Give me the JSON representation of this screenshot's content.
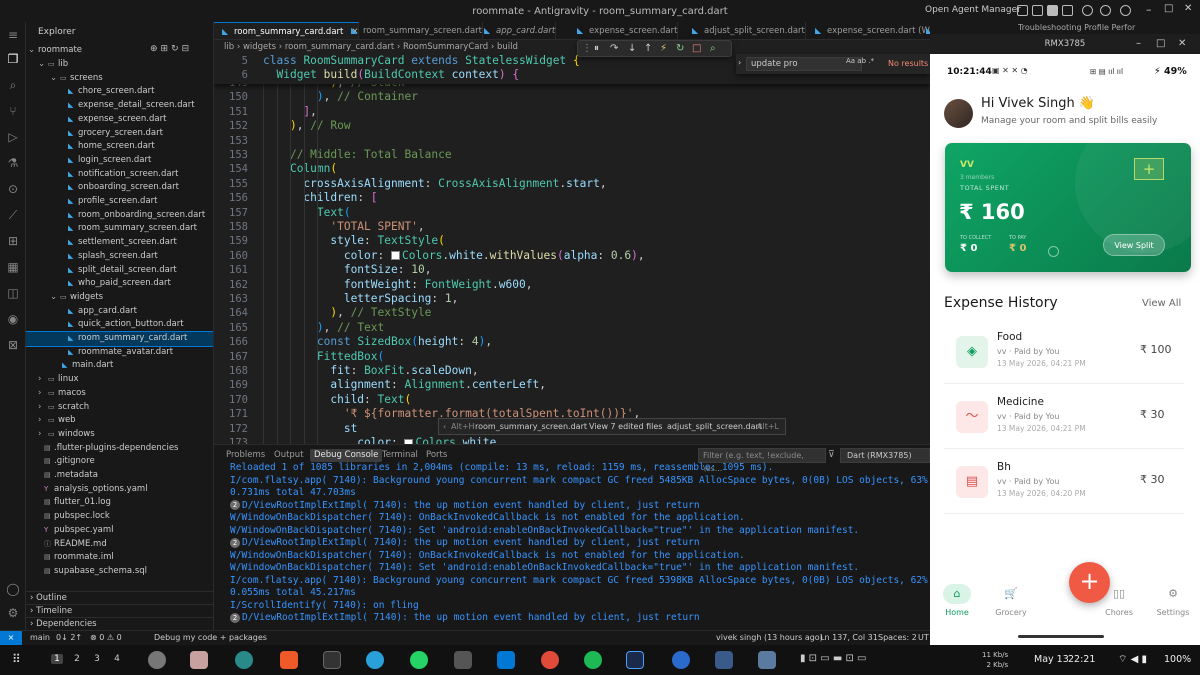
{
  "window": {
    "title": "roommate - Antigravity - room_summary_card.dart",
    "open_agent_manager": "Open Agent Manager"
  },
  "explorer": {
    "header": "Explorer",
    "root": "roommate",
    "items": [
      {
        "label": "lib",
        "kind": "folder"
      },
      {
        "label": "screens",
        "kind": "folder"
      },
      {
        "label": "chore_screen.dart",
        "kind": "dart"
      },
      {
        "label": "expense_detail_screen.dart",
        "kind": "dart"
      },
      {
        "label": "expense_screen.dart",
        "kind": "dart"
      },
      {
        "label": "grocery_screen.dart",
        "kind": "dart"
      },
      {
        "label": "home_screen.dart",
        "kind": "dart"
      },
      {
        "label": "login_screen.dart",
        "kind": "dart"
      },
      {
        "label": "notification_screen.dart",
        "kind": "dart"
      },
      {
        "label": "onboarding_screen.dart",
        "kind": "dart"
      },
      {
        "label": "profile_screen.dart",
        "kind": "dart"
      },
      {
        "label": "room_onboarding_screen.dart",
        "kind": "dart"
      },
      {
        "label": "room_summary_screen.dart",
        "kind": "dart"
      },
      {
        "label": "settlement_screen.dart",
        "kind": "dart"
      },
      {
        "label": "splash_screen.dart",
        "kind": "dart"
      },
      {
        "label": "split_detail_screen.dart",
        "kind": "dart"
      },
      {
        "label": "who_paid_screen.dart",
        "kind": "dart"
      },
      {
        "label": "widgets",
        "kind": "folder"
      },
      {
        "label": "app_card.dart",
        "kind": "dart"
      },
      {
        "label": "quick_action_button.dart",
        "kind": "dart"
      },
      {
        "label": "room_summary_card.dart",
        "kind": "dart"
      },
      {
        "label": "roommate_avatar.dart",
        "kind": "dart"
      },
      {
        "label": "main.dart",
        "kind": "dart"
      },
      {
        "label": "linux",
        "kind": "folder"
      },
      {
        "label": "macos",
        "kind": "folder"
      },
      {
        "label": "scratch",
        "kind": "folder"
      },
      {
        "label": "web",
        "kind": "folder"
      },
      {
        "label": "windows",
        "kind": "folder"
      },
      {
        "label": ".flutter-plugins-dependencies",
        "kind": "file"
      },
      {
        "label": ".gitignore",
        "kind": "file"
      },
      {
        "label": ".metadata",
        "kind": "file"
      },
      {
        "label": "analysis_options.yaml",
        "kind": "yaml"
      },
      {
        "label": "flutter_01.log",
        "kind": "file"
      },
      {
        "label": "pubspec.lock",
        "kind": "file"
      },
      {
        "label": "pubspec.yaml",
        "kind": "yaml"
      },
      {
        "label": "README.md",
        "kind": "md"
      },
      {
        "label": "roommate.iml",
        "kind": "file"
      },
      {
        "label": "supabase_schema.sql",
        "kind": "file"
      }
    ],
    "outline": "Outline",
    "timeline": "Timeline",
    "dependencies": "Dependencies"
  },
  "tabs": [
    {
      "label": "room_summary_card.dart",
      "active": true
    },
    {
      "label": "room_summary_screen.dart",
      "active": false
    },
    {
      "label": "app_card.dart",
      "active": false
    },
    {
      "label": "expense_screen.dart",
      "active": false
    },
    {
      "label": "adjust_split_screen.dart",
      "active": false
    },
    {
      "label": "expense_screen.dart (Workin",
      "active": false
    },
    {
      "label": "Troubleshooting Profile Perfor",
      "active": false
    }
  ],
  "breadcrumb": {
    "parts": [
      "lib",
      "widgets",
      "room_summary_card.dart",
      "RoomSummaryCard",
      "build"
    ]
  },
  "find": {
    "value": "update pro",
    "options": "Aa  ab  .*",
    "result": "No results"
  },
  "editor": {
    "sticky": [
      {
        "n": "5",
        "code": "<span class=\"kw\">class</span> <span class=\"ty\">RoomSummaryCard</span> <span class=\"kw\">extends</span> <span class=\"ty\">StatelessWidget</span> <span class=\"br1\">{</span>"
      },
      {
        "n": "6",
        "code": "  <span class=\"ty\">Widget</span> <span class=\"fn\">build</span><span class=\"br2\">(</span><span class=\"ty\">BuildContext</span> <span class=\"pr\">context</span><span class=\"br2\">)</span> <span class=\"br2\">{</span>"
      }
    ],
    "lines": [
      {
        "n": "149",
        "code": "          <span class=\"br1\">)</span>, <span class=\"cm\">// Stack</span>"
      },
      {
        "n": "150",
        "code": "        <span class=\"br3\">)</span>, <span class=\"cm\">// Container</span>"
      },
      {
        "n": "151",
        "code": "      <span class=\"br2\">]</span>,"
      },
      {
        "n": "152",
        "code": "    <span class=\"br1\">)</span>, <span class=\"cm\">// Row</span>"
      },
      {
        "n": "153",
        "code": ""
      },
      {
        "n": "153",
        "code": "    <span class=\"cm\">// Middle: Total Balance</span>"
      },
      {
        "n": "154",
        "code": "    <span class=\"ty\">Column</span><span class=\"br1\">(</span>"
      },
      {
        "n": "155",
        "code": "      <span class=\"pr\">crossAxisAlignment</span>: <span class=\"ty\">CrossAxisAlignment</span>.<span class=\"pr\">start</span>,"
      },
      {
        "n": "156",
        "code": "      <span class=\"pr\">children</span>: <span class=\"br2\">[</span>"
      },
      {
        "n": "157",
        "code": "        <span class=\"ty\">Text</span><span class=\"br3\">(</span>"
      },
      {
        "n": "158",
        "code": "          <span class=\"st\">'TOTAL SPENT'</span>,"
      },
      {
        "n": "159",
        "code": "          <span class=\"pr\">style</span>: <span class=\"ty\">TextStyle</span><span class=\"br1\">(</span>"
      },
      {
        "n": "160",
        "code": "            <span class=\"pr\">color</span>: <span class=\"swatch\"></span><span class=\"ty\">Colors</span>.<span class=\"pr\">white</span>.<span class=\"fn\">withValues</span><span class=\"br2\">(</span><span class=\"pr\">alpha</span>: <span class=\"nu\">0.6</span><span class=\"br2\">)</span>,"
      },
      {
        "n": "161",
        "code": "            <span class=\"pr\">fontSize</span>: <span class=\"nu\">10</span>,"
      },
      {
        "n": "162",
        "code": "            <span class=\"pr\">fontWeight</span>: <span class=\"ty\">FontWeight</span>.<span class=\"pr\">w600</span>,"
      },
      {
        "n": "163",
        "code": "            <span class=\"pr\">letterSpacing</span>: <span class=\"nu\">1</span>,"
      },
      {
        "n": "164",
        "code": "          <span class=\"br1\">)</span>, <span class=\"cm\">// TextStyle</span>"
      },
      {
        "n": "165",
        "code": "        <span class=\"br3\">)</span>, <span class=\"cm\">// Text</span>"
      },
      {
        "n": "166",
        "code": "        <span class=\"kw\">const</span> <span class=\"ty\">SizedBox</span><span class=\"br3\">(</span><span class=\"pr\">height</span>: <span class=\"nu\">4</span><span class=\"br3\">)</span>,"
      },
      {
        "n": "167",
        "code": "        <span class=\"ty\">FittedBox</span><span class=\"br3\">(</span>"
      },
      {
        "n": "168",
        "code": "          <span class=\"pr\">fit</span>: <span class=\"ty\">BoxFit</span>.<span class=\"pr\">scaleDown</span>,"
      },
      {
        "n": "169",
        "code": "          <span class=\"pr\">alignment</span>: <span class=\"ty\">Alignment</span>.<span class=\"pr\">centerLeft</span>,"
      },
      {
        "n": "170",
        "code": "          <span class=\"pr\">child</span>: <span class=\"ty\">Text</span><span class=\"br1\">(</span>"
      },
      {
        "n": "171",
        "code": "            <span class=\"st\">'₹ ${formatter.format(totalSpent.toInt())}'</span>,"
      },
      {
        "n": "172",
        "code": "            <span class=\"pr\">st</span>"
      },
      {
        "n": "173",
        "code": "              <span class=\"pr\">color</span>: <span class=\"swatch\"></span><span class=\"ty\">Colors</span>.<span class=\"pr\">white</span>,"
      }
    ]
  },
  "switcher": {
    "hint": "Alt+H",
    "item1": "room_summary_screen.dart",
    "item2": "View 7 edited files",
    "item3": "adjust_split_screen.dart",
    "hint2": "Alt+L"
  },
  "panel": {
    "tabs": [
      "Problems",
      "Output",
      "Debug Console",
      "Terminal",
      "Ports"
    ],
    "active_tab": "Debug Console",
    "filter_placeholder": "Filter (e.g. text, !exclude, \\es...",
    "device": "Dart (RMX3785)",
    "logs": [
      {
        "badge": "",
        "text": "Reloaded 1 of 1085 libraries in 2,004ms (compile: 13 ms, reload: 1159 ms, reassemble: 1095 ms)."
      },
      {
        "badge": "",
        "text": "I/com.flatsy.app( 7140): Background young concurrent mark compact GC freed 5485KB AllocSpace bytes, 0(0B) LOS objects, 63% free, 3191KB/8650KB"
      },
      {
        "badge": "",
        "text": "0.731ms total 47.703ms"
      },
      {
        "badge": "2",
        "text": "D/ViewRootImplExtImpl( 7140): the up motion event handled by client, just return"
      },
      {
        "badge": "",
        "text": "W/WindowOnBackDispatcher( 7140): OnBackInvokedCallback is not enabled for the application."
      },
      {
        "badge": "",
        "text": "W/WindowOnBackDispatcher( 7140): Set 'android:enableOnBackInvokedCallback=\"true\"' in the application manifest."
      },
      {
        "badge": "2",
        "text": "D/ViewRootImplExtImpl( 7140): the up motion event handled by client, just return"
      },
      {
        "badge": "",
        "text": "W/WindowOnBackDispatcher( 7140): OnBackInvokedCallback is not enabled for the application."
      },
      {
        "badge": "",
        "text": "W/WindowOnBackDispatcher( 7140): Set 'android:enableOnBackInvokedCallback=\"true\"' in the application manifest."
      },
      {
        "badge": "",
        "text": "I/com.flatsy.app( 7140): Background young concurrent mark compact GC freed 5398KB AllocSpace bytes, 0(0B) LOS objects, 62% free, 3279KB/8650KB"
      },
      {
        "badge": "",
        "text": "0.055ms total 45.217ms"
      },
      {
        "badge": "",
        "text": "I/ScrollIdentify( 7140): on fling"
      },
      {
        "badge": "2",
        "text": "D/ViewRootImplExtImpl( 7140): the up motion event handled by client, just return"
      }
    ]
  },
  "status": {
    "branch": "main",
    "sync": "0↓ 2↑",
    "errors": "⊗ 0 ⚠ 0",
    "debug": "Debug my code + packages",
    "blame": "vivek singh (13 hours ago)",
    "position": "Ln 137, Col 31",
    "spaces": "Spaces: 2",
    "encoding": "UT"
  },
  "emulator": {
    "title": "RMX3785",
    "top_text": "Troubleshooting Profile Perfor"
  },
  "phone": {
    "time": "10:21:44",
    "battery": "49%",
    "greeting": "Hi Vivek Singh 👋",
    "subtitle": "Manage your room and split bills easily",
    "card": {
      "group": "VV",
      "members": "3 members",
      "total_label": "TOTAL SPENT",
      "total": "₹ 160",
      "collect_label": "TO COLLECT",
      "collect": "₹ 0",
      "pay_label": "TO PAY",
      "pay": "₹ 0",
      "view_split": "View Split"
    },
    "history_title": "Expense History",
    "view_all": "View All",
    "expenses": [
      {
        "name": "Food",
        "by": "vv · Paid by You",
        "date": "13 May 2026, 04:21 PM",
        "amount": "₹ 100",
        "icon": "bag-icon",
        "bg": "#e3f5ea",
        "fg": "#0f9b5f"
      },
      {
        "name": "Medicine",
        "by": "vv · Paid by You",
        "date": "13 May 2026, 04:21 PM",
        "amount": "₹ 30",
        "icon": "pulse-icon",
        "bg": "#fde7e7",
        "fg": "#d9534f"
      },
      {
        "name": "Bh",
        "by": "vv · Paid by You",
        "date": "13 May 2026, 04:20 PM",
        "amount": "₹ 30",
        "icon": "receipt-icon",
        "bg": "#fde7e7",
        "fg": "#d9534f"
      }
    ],
    "nav": [
      "Home",
      "Grocery",
      "",
      "Chores",
      "Settings"
    ]
  },
  "taskbar": {
    "workspaces": [
      "1",
      "2",
      "3",
      "4"
    ],
    "net_down": "11 Kb/s",
    "net_up": "2 Kb/s",
    "date": "May 13",
    "clock": "22:21",
    "battery": "100%"
  },
  "colors": {
    "accent": "#0078d4",
    "green": "#0f9b5f",
    "fab": "#f05a44"
  }
}
